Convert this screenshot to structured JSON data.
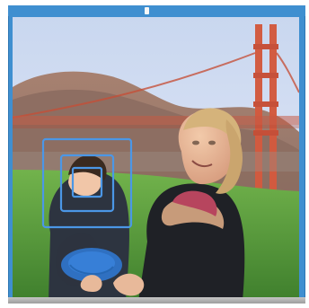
{
  "window": {
    "accent_color": "#3f8fd0",
    "frame_bottom_color": "#a9a9a9"
  },
  "photo": {
    "scene": "portrait-in-front-of-bridge",
    "subjects": [
      "background-person",
      "foreground-person"
    ],
    "detections": {
      "type": "face-detection",
      "rectangles_count": 3,
      "stroke_color": "#4b97e6"
    },
    "object_highlight": {
      "name": "frisbee",
      "fill_color": "#2f74c8"
    }
  }
}
